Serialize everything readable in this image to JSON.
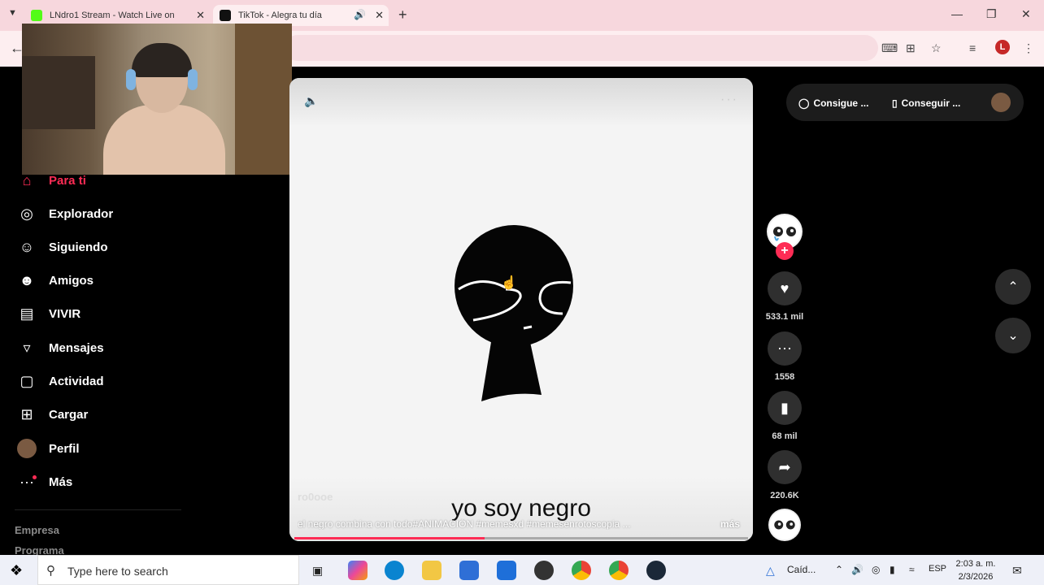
{
  "browser": {
    "tabs": [
      {
        "title": "LNdro1 Stream - Watch Live on",
        "active": false,
        "favicon_color": "#53fc18"
      },
      {
        "title": "TikTok - Alegra tu día",
        "active": true,
        "favicon_color": "#111111"
      }
    ],
    "profile_initial": "L"
  },
  "sidebar": {
    "items": [
      {
        "label": "Para ti",
        "icon": "home-icon",
        "active": true
      },
      {
        "label": "Explorador",
        "icon": "compass-icon"
      },
      {
        "label": "Siguiendo",
        "icon": "following-icon"
      },
      {
        "label": "Amigos",
        "icon": "friends-icon"
      },
      {
        "label": "VIVIR",
        "icon": "live-tv-icon"
      },
      {
        "label": "Mensajes",
        "icon": "send-icon"
      },
      {
        "label": "Actividad",
        "icon": "activity-icon"
      },
      {
        "label": "Cargar",
        "icon": "upload-icon"
      },
      {
        "label": "Perfil",
        "icon": "profile-avatar-icon"
      },
      {
        "label": "Más",
        "icon": "more-dots-icon"
      }
    ],
    "footer": [
      "Empresa",
      "Programa"
    ]
  },
  "video": {
    "author": "ro0ooe",
    "subtitle": "yo soy negro",
    "caption": "el negro combina con todo#ANIMACIÓN #memesxd #memesenrotoscopia ...",
    "more_label": "más",
    "progress": 0.42
  },
  "actions": {
    "likes": "533.1 mil",
    "comments": "1558",
    "saves": "68 mil",
    "shares": "220.6K"
  },
  "topbar": {
    "get_coins": "Consigue ...",
    "get_app": "Conseguir ..."
  },
  "taskbar": {
    "search_placeholder": "Type here to search",
    "weather": "Caíd...",
    "language": "ESP",
    "time": "2:03 a. m.",
    "date": "2/3/2026"
  }
}
